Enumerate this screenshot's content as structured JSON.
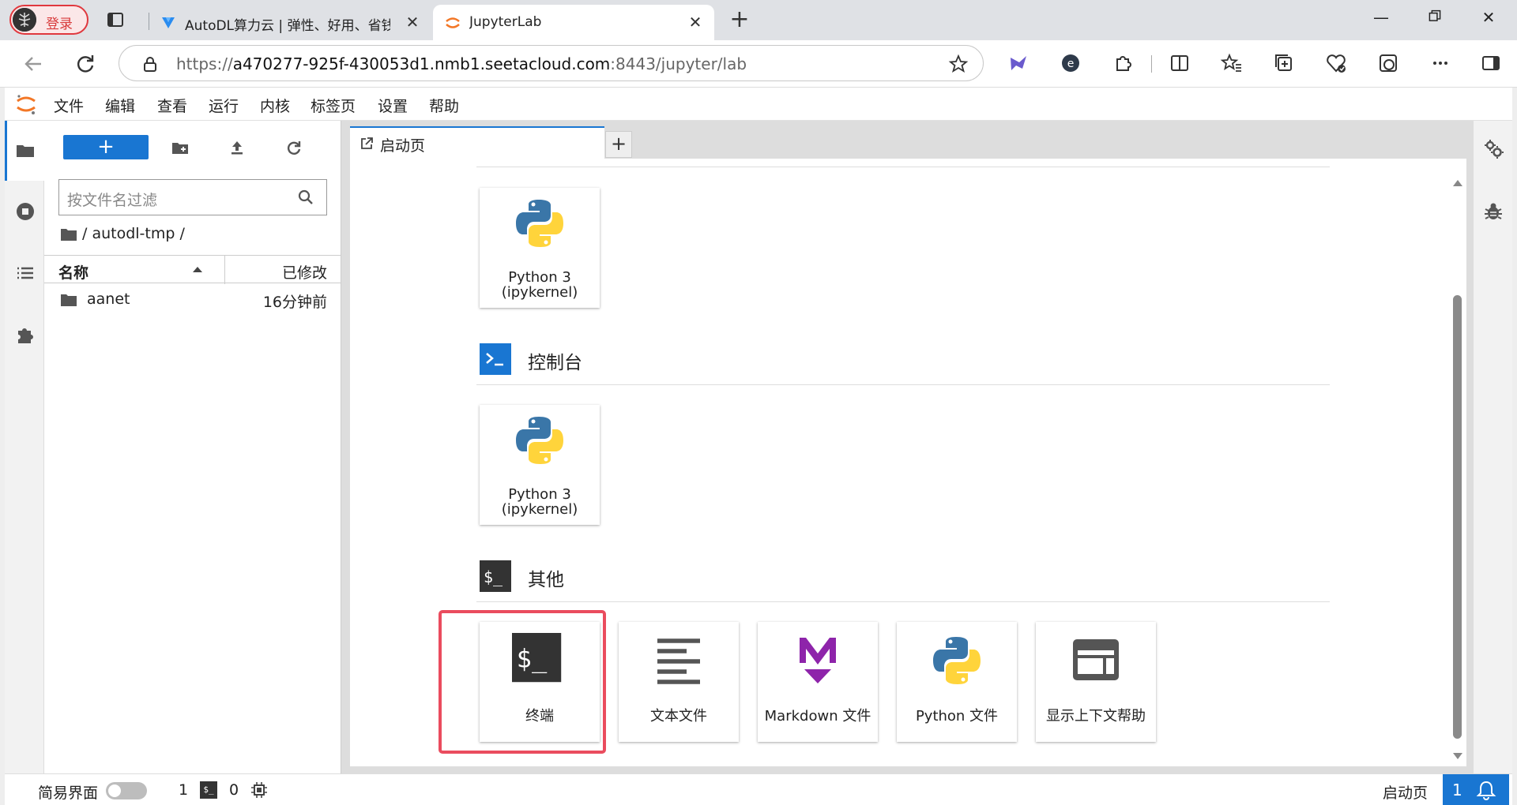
{
  "browser": {
    "profile_label": "登录",
    "tabs": [
      {
        "title": "AutoDL算力云 | 弹性、好用、省钱"
      },
      {
        "title": "JupyterLab"
      }
    ],
    "url_prefix": "https://",
    "url_host": "a470277-925f-430053d1.nmb1.seetacloud.com",
    "url_rest": ":8443/jupyter/lab"
  },
  "menubar": {
    "items": [
      "文件",
      "编辑",
      "查看",
      "运行",
      "内核",
      "标签页",
      "设置",
      "帮助"
    ]
  },
  "filebrowser": {
    "new_label": "+",
    "filter_placeholder": "按文件名过滤",
    "breadcrumb": "/ autodl-tmp /",
    "col_name": "名称",
    "col_modified": "已修改",
    "rows": [
      {
        "name": "aanet",
        "modified": "16分钟前"
      }
    ]
  },
  "main": {
    "tab_label": "启动页",
    "add_tab_label": "+",
    "notebook_card": {
      "line1": "Python 3",
      "line2": "(ipykernel)"
    },
    "console_section": {
      "title": "控制台",
      "icon_text": ">_"
    },
    "console_card": {
      "line1": "Python 3",
      "line2": "(ipykernel)"
    },
    "other_section": {
      "title": "其他",
      "icon_text": "$_"
    },
    "other_cards": [
      {
        "label": "终端",
        "icon": "terminal-icon"
      },
      {
        "label": "文本文件",
        "icon": "text-file-icon"
      },
      {
        "label": "Markdown 文件",
        "icon": "markdown-icon"
      },
      {
        "label": "Python 文件",
        "icon": "python-icon"
      },
      {
        "label": "显示上下文帮助",
        "icon": "context-help-icon"
      }
    ]
  },
  "statusbar": {
    "simple_mode_label": "简易界面",
    "terminals_count": "1",
    "terminal_glyph": "$_",
    "kernels_count": "0",
    "active_tab_label": "启动页",
    "notification_count": "1"
  },
  "colors": {
    "accent": "#1976d2",
    "highlight": "#ea4c5e",
    "python_blue": "#3a76a8",
    "python_yellow": "#ffd43b",
    "markdown_purple": "#8e24aa"
  }
}
